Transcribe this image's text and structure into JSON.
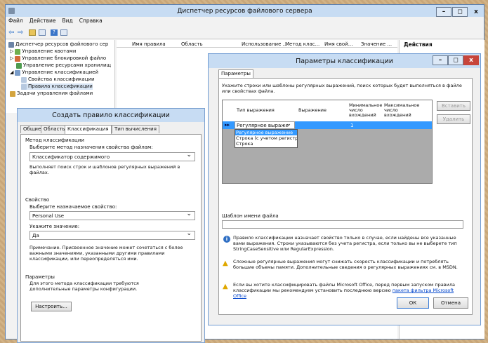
{
  "main_window": {
    "title": "Диспетчер ресурсов файлового сервера",
    "menu": [
      "Файл",
      "Действие",
      "Вид",
      "Справка"
    ],
    "tree": [
      "Диспетчер ресурсов файлового сер",
      "Управление квотами",
      "Управление блокировкой файло",
      "Управление ресурсами хранилищ",
      "Управление классификацией",
      "Свойства классификации",
      "Правила классификации",
      "Задачи управления файлами"
    ],
    "columns": [
      "Имя правила",
      "Область",
      "Использование ...",
      "Метод клас...",
      "Имя свой...",
      "Значение ..."
    ],
    "actions_title": "Действия"
  },
  "create_rule": {
    "title": "Создать правило классификации",
    "tabs": [
      "Общие",
      "Область",
      "Классификация",
      "Тип вычисления"
    ],
    "method_group": "Метод классификации",
    "method_label": "Выберите метод назначения свойства файлам:",
    "method_value": "Классификатор содержимого",
    "method_desc": "Выполняет поиск строк и шаблонов регулярных выражений в файлах.",
    "property_group": "Свойство",
    "property_label": "Выберите назначаемое свойство:",
    "property_value": "Personal Use",
    "value_label": "Укажите значение:",
    "value_value": "Да",
    "note": "Примечание. Присвоенное значение может сочетаться с более важными значениями, указанными другими правилами классификации, или переопределяться ими.",
    "params_group": "Параметры",
    "params_desc": "Для этого метода классификации требуются дополнительные параметры конфигурации.",
    "configure_button": "Настроить..."
  },
  "params_dialog": {
    "title": "Параметры классификации",
    "tab": "Параметры",
    "instruction": "Укажите строки или шаблоны регулярных выражений, поиск которых будет выполняться в файле или свойствах файла.",
    "grid_headers": [
      "Тип выражения",
      "Выражение",
      "Минимальное число вхождений",
      "Максимальное число вхождений"
    ],
    "row_type": "Регулярное выраже",
    "row_min": "1",
    "dropdown_options": [
      "Регулярное выражение",
      "Строка (с учетом регистр",
      "Строка"
    ],
    "insert_button": "Вставить",
    "delete_button": "Удалить",
    "filename_label": "Шаблон имени файла",
    "info_text": "Правило классификации назначает свойство только в случае, если найдены все указанные вами выражения. Строки указываются без учета регистра, если только вы не выберете тип StringCaseSensitive или RegularExpression.",
    "warn_text": "Сложные регулярные выражения могут снижать скорость классификации и потреблять большие объемы памяти. Дополнительные сведения о регулярных выражениях см. в MSDN.",
    "office_text": "Если вы хотите классифицировать файлы Microsoft Office, перед первым запуском правила классификации мы рекомендуем установить последнюю версию ",
    "office_link": "пакета фильтра Microsoft Office",
    "ok_button": "ОК",
    "cancel_button": "Отмена"
  },
  "colors": {
    "title_blue": "#c7dcf3",
    "close_red": "#c7453b",
    "selection": "#3399ff",
    "link": "#0044cc"
  }
}
